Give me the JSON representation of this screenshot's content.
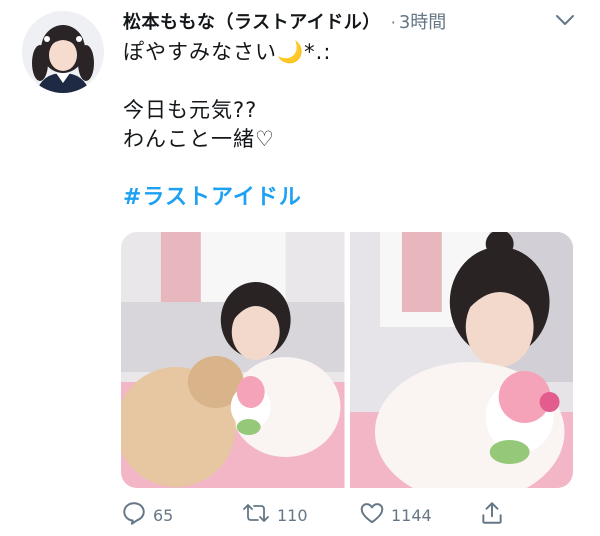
{
  "author": {
    "display_name": "松本ももな（ラストアイドル）",
    "separator": "·",
    "timestamp": "3時間"
  },
  "tweet": {
    "line1_text": "ぽやすみなさい",
    "line1_moon": "🌙",
    "line1_sparkle": "*.:",
    "line2": "今日も元気??",
    "line3": "わんこと一緒♡",
    "hashtag": "#ラストアイドル"
  },
  "actions": {
    "reply_count": "65",
    "retweet_count": "110",
    "like_count": "1144"
  },
  "icons": {
    "caret": "chevron-down-icon",
    "reply": "reply-icon",
    "retweet": "retweet-icon",
    "like": "heart-icon",
    "share": "share-icon"
  },
  "colors": {
    "text": "#14171a",
    "secondary": "#657786",
    "link": "#1da1f2",
    "moon": "#f5c518"
  }
}
